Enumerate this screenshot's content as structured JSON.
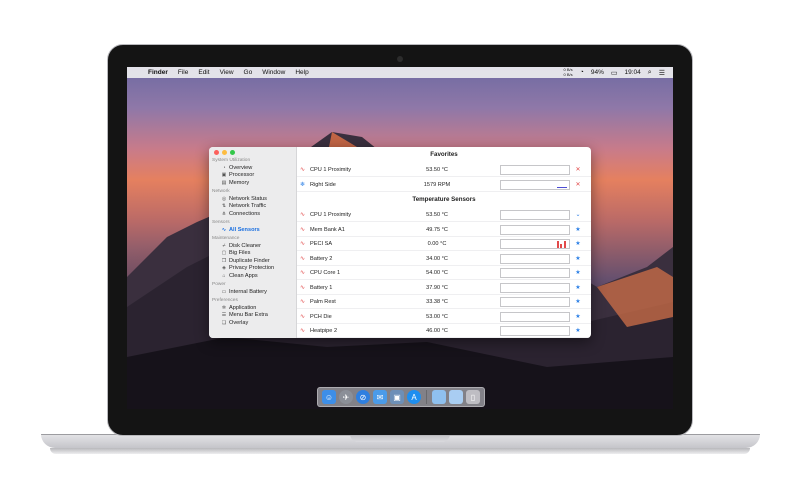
{
  "menubar": {
    "app_name": "Finder",
    "items": [
      "File",
      "Edit",
      "View",
      "Go",
      "Window",
      "Help"
    ],
    "net_up": "0 B/s",
    "net_down": "0 B/s",
    "battery": "94%",
    "time": "19:04",
    "icons": [
      "apple-icon",
      "wifi-icon",
      "battery-icon",
      "spotlight-icon",
      "notification-center-icon"
    ]
  },
  "sidebar": {
    "sections": [
      {
        "title": "System Utilization",
        "items": [
          {
            "label": "Overview",
            "icon": "gauge-icon"
          },
          {
            "label": "Processor",
            "icon": "chip-icon"
          },
          {
            "label": "Memory",
            "icon": "memory-icon"
          }
        ]
      },
      {
        "title": "Network",
        "items": [
          {
            "label": "Network Status",
            "icon": "globe-icon"
          },
          {
            "label": "Network Traffic",
            "icon": "traffic-icon"
          },
          {
            "label": "Connections",
            "icon": "connections-icon"
          }
        ]
      },
      {
        "title": "Sensors",
        "items": [
          {
            "label": "All Sensors",
            "icon": "sensor-icon",
            "active": true
          }
        ]
      },
      {
        "title": "Maintenance",
        "items": [
          {
            "label": "Disk Cleaner",
            "icon": "broom-icon"
          },
          {
            "label": "Big Files",
            "icon": "file-icon"
          },
          {
            "label": "Duplicate Finder",
            "icon": "duplicate-icon"
          },
          {
            "label": "Privacy Protection",
            "icon": "shield-icon"
          },
          {
            "label": "Clean Apps",
            "icon": "app-icon"
          }
        ]
      },
      {
        "title": "Power",
        "items": [
          {
            "label": "Internal Battery",
            "icon": "battery-icon"
          }
        ]
      },
      {
        "title": "Preferences",
        "items": [
          {
            "label": "Application",
            "icon": "gear-icon"
          },
          {
            "label": "Menu Bar Extra",
            "icon": "menubar-icon"
          },
          {
            "label": "Overlay",
            "icon": "overlay-icon"
          }
        ]
      }
    ]
  },
  "favorites": {
    "title": "Favorites",
    "rows": [
      {
        "name": "CPU 1 Proximity",
        "value": "53.50 °C",
        "kind": "temp",
        "action": "remove"
      },
      {
        "name": "Right Side",
        "value": "1579 RPM",
        "kind": "fan",
        "action": "remove"
      }
    ]
  },
  "temperature": {
    "title": "Temperature Sensors",
    "rows": [
      {
        "name": "CPU 1 Proximity",
        "value": "53.50 °C",
        "action": "favorited"
      },
      {
        "name": "Mem Bank A1",
        "value": "49.75 °C",
        "action": "star"
      },
      {
        "name": "PECI SA",
        "value": "0.00 °C",
        "action": "star"
      },
      {
        "name": "Battery 2",
        "value": "34.00 °C",
        "action": "star"
      },
      {
        "name": "CPU Core 1",
        "value": "54.00 °C",
        "action": "star"
      },
      {
        "name": "Battery 1",
        "value": "37.90 °C",
        "action": "star"
      },
      {
        "name": "Palm Rest",
        "value": "33.38 °C",
        "action": "star"
      },
      {
        "name": "PCH Die",
        "value": "53.00 °C",
        "action": "star"
      },
      {
        "name": "Heatpipe 2",
        "value": "46.00 °C",
        "action": "star"
      }
    ]
  },
  "dock": {
    "apps": [
      "finder-icon",
      "launchpad-icon",
      "safari-icon",
      "mail-icon",
      "photos-icon",
      "app-store-icon",
      "folder-icon",
      "downloads-icon",
      "trash-icon"
    ]
  },
  "colors": {
    "accent": "#1a6fe0",
    "alert": "#e24a4a"
  }
}
